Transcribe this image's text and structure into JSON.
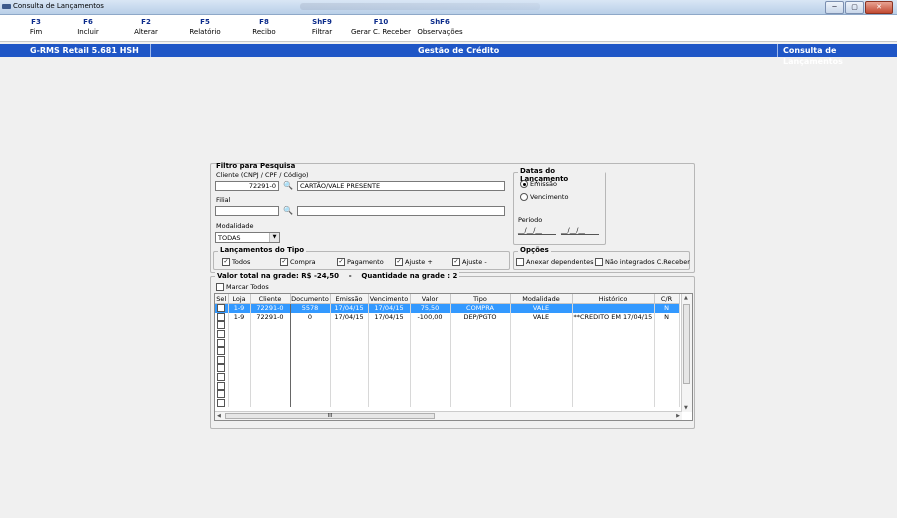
{
  "window": {
    "title": "Consulta de Lançamentos",
    "controls": [
      "─",
      "▢",
      "✕"
    ]
  },
  "toolbar": [
    {
      "key": "F3",
      "label": "Fim"
    },
    {
      "key": "F6",
      "label": "Incluir"
    },
    {
      "key": "F2",
      "label": "Alterar"
    },
    {
      "key": "F5",
      "label": "Relatório"
    },
    {
      "key": "F8",
      "label": "Recibo"
    },
    {
      "key": "ShF9",
      "label": "Filtrar"
    },
    {
      "key": "F10",
      "label": "Gerar C. Receber"
    },
    {
      "key": "ShF6",
      "label": "Observações"
    }
  ],
  "header": {
    "app": "G-RMS Retail 5.681 HSH",
    "module": "Gestão de Crédito",
    "screen": "Consulta de Lançamentos"
  },
  "filter": {
    "title": "Filtro para Pesquisa",
    "cliente_label": "Cliente (CNPJ / CPF / Código)",
    "cliente_code": "72291-0",
    "cliente_name": "CARTÃO/VALE PRESENTE",
    "filial_label": "Filial",
    "filial_code": "",
    "filial_name": "",
    "modalidade_label": "Modalidade",
    "modalidade_value": "TODAS"
  },
  "datas": {
    "title": "Datas do Lançamento",
    "emissao": "Emissão",
    "vencimento": "Vencimento",
    "periodo_label": "Período",
    "periodo_de": "__/__/__",
    "periodo_ate": "__/__/__"
  },
  "tipos": {
    "title": "Lançamentos do Tipo",
    "todos": "Todos",
    "compra": "Compra",
    "pagamento": "Pagamento",
    "ajuste_mais": "Ajuste +",
    "ajuste_menos": "Ajuste -"
  },
  "opcoes": {
    "title": "Opções",
    "anexar": "Anexar dependentes",
    "nao_integrados": "Não integrados C.Receber"
  },
  "summary": {
    "valor_label": "Valor total na grade:",
    "valor": "R$ -24,50",
    "dash": "-",
    "quantidade_label": "Quantidade na grade :",
    "quantidade": "2",
    "marcar_todos": "Marcar Todos"
  },
  "grid": {
    "columns": [
      "Sel",
      "Loja",
      "Cliente",
      "Documento",
      "Emissão",
      "Vencimento",
      "Valor",
      "Tipo",
      "Modalidade",
      "Histórico",
      "C/R"
    ],
    "rows": [
      [
        "",
        "1-9",
        "72291-0",
        "5578",
        "17/04/15",
        "17/04/15",
        "75,50",
        "COMPRA",
        "VALE",
        "",
        "N"
      ],
      [
        "",
        "1-9",
        "72291-0",
        "0",
        "17/04/15",
        "17/04/15",
        "-100,00",
        "DEP/PGTO",
        "VALE",
        "**CREDITO EM 17/04/15",
        "N"
      ],
      [
        "",
        "",
        "",
        "",
        "",
        "",
        "",
        "",
        "",
        "",
        ""
      ],
      [
        "",
        "",
        "",
        "",
        "",
        "",
        "",
        "",
        "",
        "",
        ""
      ],
      [
        "",
        "",
        "",
        "",
        "",
        "",
        "",
        "",
        "",
        "",
        ""
      ],
      [
        "",
        "",
        "",
        "",
        "",
        "",
        "",
        "",
        "",
        "",
        ""
      ],
      [
        "",
        "",
        "",
        "",
        "",
        "",
        "",
        "",
        "",
        "",
        ""
      ],
      [
        "",
        "",
        "",
        "",
        "",
        "",
        "",
        "",
        "",
        "",
        ""
      ],
      [
        "",
        "",
        "",
        "",
        "",
        "",
        "",
        "",
        "",
        "",
        ""
      ],
      [
        "",
        "",
        "",
        "",
        "",
        "",
        "",
        "",
        "",
        "",
        ""
      ],
      [
        "",
        "",
        "",
        "",
        "",
        "",
        "",
        "",
        "",
        "",
        ""
      ],
      [
        "",
        "",
        "",
        "",
        "",
        "",
        "",
        "",
        "",
        "",
        ""
      ]
    ],
    "hscroll_label": "III"
  }
}
